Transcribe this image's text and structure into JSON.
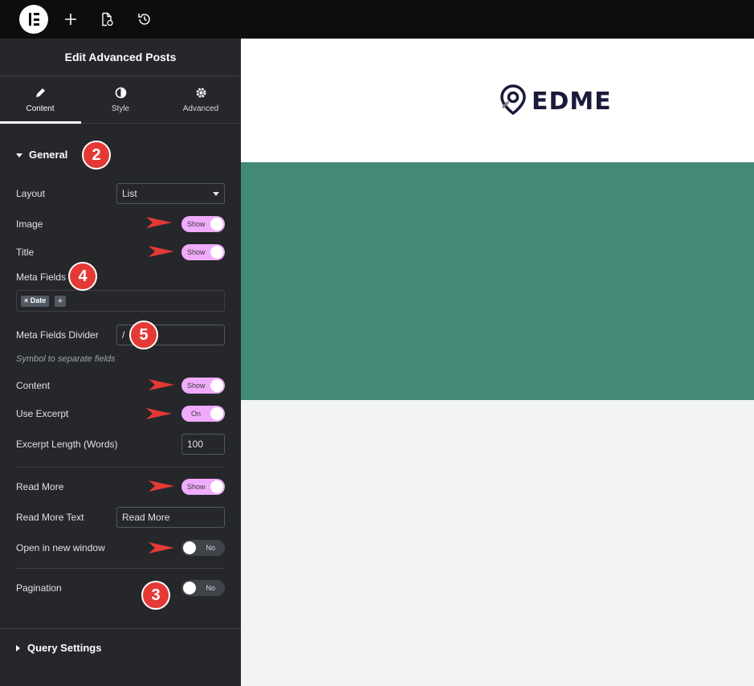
{
  "topbar": {
    "logo": "elementor-logo",
    "icons": [
      "plus-icon",
      "page-settings-icon",
      "history-icon"
    ]
  },
  "panel": {
    "title": "Edit Advanced Posts",
    "tabs": [
      {
        "label": "Content",
        "icon": "pencil-icon",
        "active": true
      },
      {
        "label": "Style",
        "icon": "half-circle-icon",
        "active": false
      },
      {
        "label": "Advanced",
        "icon": "gear-icon",
        "active": false
      }
    ],
    "general": {
      "title": "General",
      "layout": {
        "label": "Layout",
        "value": "List"
      },
      "image": {
        "label": "Image",
        "toggle": "Show"
      },
      "title_field": {
        "label": "Title",
        "toggle": "Show"
      },
      "meta_fields": {
        "label": "Meta Fields",
        "tags": [
          "Date"
        ],
        "add": "+"
      },
      "meta_divider": {
        "label": "Meta Fields Divider",
        "value": "/",
        "hint": "Symbol to separate fields"
      },
      "content": {
        "label": "Content",
        "toggle": "Show"
      },
      "use_excerpt": {
        "label": "Use Excerpt",
        "toggle": "On"
      },
      "excerpt_length": {
        "label": "Excerpt Length (Words)",
        "value": "100"
      },
      "read_more": {
        "label": "Read More",
        "toggle": "Show"
      },
      "read_more_text": {
        "label": "Read More Text",
        "value": "Read More"
      },
      "open_new_window": {
        "label": "Open in new window",
        "toggle": "No"
      },
      "pagination": {
        "label": "Pagination",
        "toggle": "No"
      }
    },
    "query_settings": {
      "title": "Query Settings"
    },
    "badges": [
      "2",
      "3",
      "4",
      "5"
    ]
  },
  "canvas": {
    "brand": "EDME",
    "colors": {
      "header": "#ffffff",
      "hero": "#438a76",
      "body": "#f1f3f5"
    }
  },
  "colors": {
    "toggle_on": "#f0abfc",
    "toggle_off": "#3f444b",
    "panel": "#26272b",
    "badge": "#e53935"
  }
}
